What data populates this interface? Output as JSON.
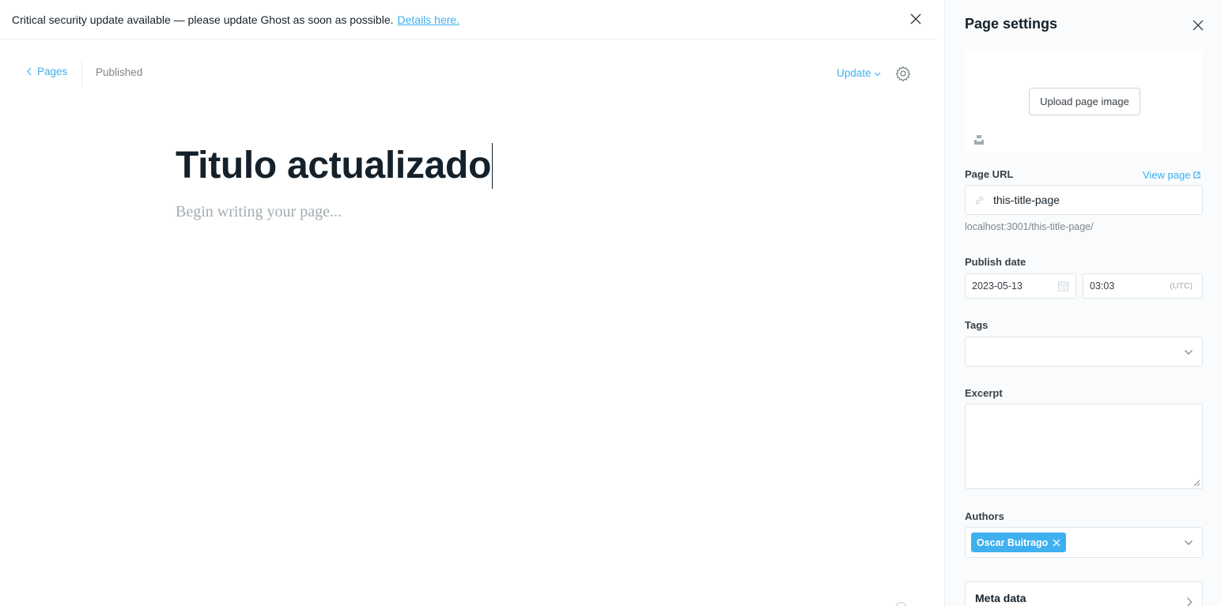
{
  "alert": {
    "message": "Critical security update available — please update Ghost as soon as possible.",
    "link_label": "Details here."
  },
  "editor": {
    "back_label": "Pages",
    "status": "Published",
    "update_label": "Update",
    "title": "Titulo actualizado",
    "body_placeholder": "Begin writing your page..."
  },
  "panel": {
    "title": "Page settings",
    "upload_label": "Upload page image",
    "url_label": "Page URL",
    "view_page_label": "View page",
    "url_value": "this-title-page",
    "url_hint": "localhost:3001/this-title-page/",
    "publish_date_label": "Publish date",
    "date_value": "2023-05-13",
    "time_value": "03:03",
    "timezone": "(UTC)",
    "tags_label": "Tags",
    "excerpt_label": "Excerpt",
    "authors_label": "Authors",
    "author": "Oscar Buitrago",
    "meta_label": "Meta data"
  },
  "colors": {
    "accent": "#3eb0ef",
    "text": "#15212a",
    "muted": "#7d878a",
    "panel_bg": "#f9fbfc"
  },
  "icons": [
    "close-icon",
    "chevron-left-icon",
    "chevron-down-icon",
    "gear-icon",
    "unsplash-icon",
    "external-link-icon",
    "link-icon",
    "calendar-icon",
    "remove-token-icon",
    "chevron-right-icon"
  ]
}
